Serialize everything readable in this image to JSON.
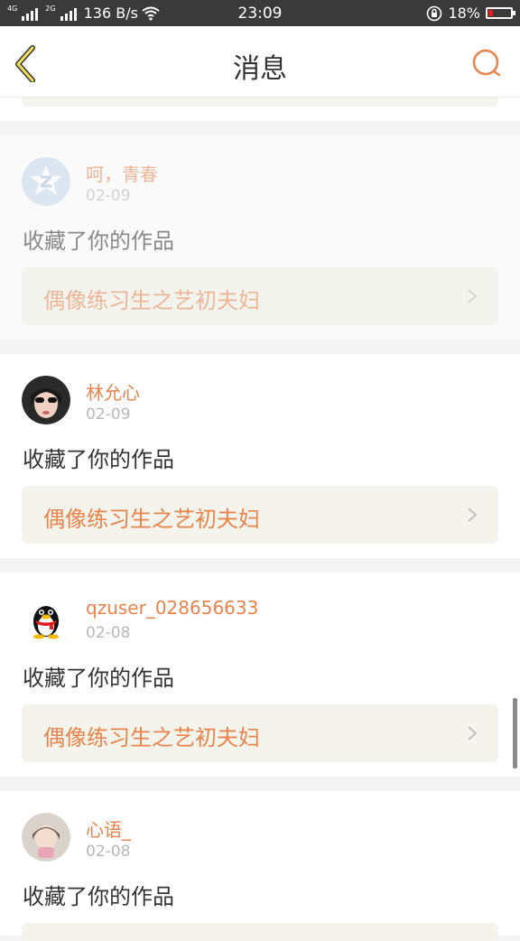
{
  "status_bar": {
    "network_1": "4G",
    "network_2": "2G",
    "speed": "136 B/s",
    "time": "23:09",
    "battery": "18%",
    "battery_color": "#e02020"
  },
  "nav": {
    "back_icon": "chevron-left-icon",
    "title": "消息",
    "search_icon": "search-icon",
    "accent_color": "#e8834c"
  },
  "messages": [
    {
      "user": "呵，青春",
      "date": "02-09",
      "action": "收藏了你的作品",
      "work": "偶像练习生之艺初夫妇",
      "avatar": "qzone-default-avatar"
    },
    {
      "user": "林允心",
      "date": "02-09",
      "action": "收藏了你的作品",
      "work": "偶像练习生之艺初夫妇",
      "avatar": "photo-avatar"
    },
    {
      "user": "qzuser_028656633",
      "date": "02-08",
      "action": "收藏了你的作品",
      "work": "偶像练习生之艺初夫妇",
      "avatar": "qq-penguin-avatar"
    },
    {
      "user": "心语_",
      "date": "02-08",
      "action": "收藏了你的作品",
      "avatar": "photo-avatar"
    }
  ]
}
